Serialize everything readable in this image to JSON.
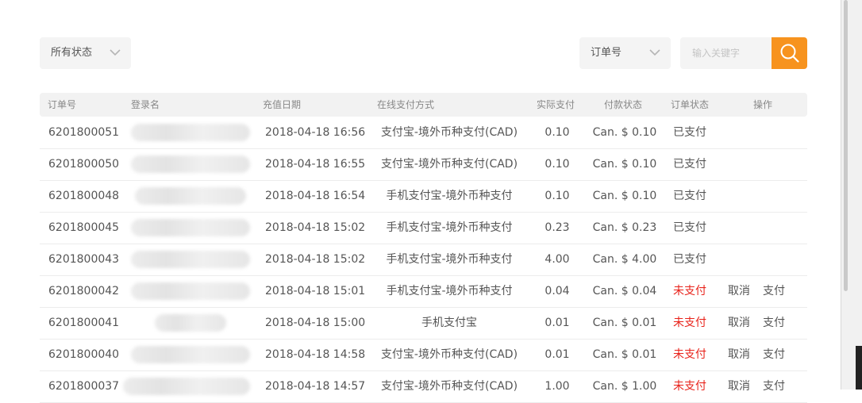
{
  "filters": {
    "status_select": "所有状态",
    "field_select": "订单号",
    "search_placeholder": "输入关键字"
  },
  "table": {
    "headers": [
      "订单号",
      "登录名",
      "充值日期",
      "在线支付方式",
      "实际支付",
      "付款状态",
      "订单状态",
      "操作"
    ],
    "rows": [
      {
        "id": "6201800051",
        "date": "2018-04-18 16:56",
        "method": "支付宝-境外币种支付(CAD)",
        "amount": "0.10",
        "payment": "Can. $ 0.10",
        "status": "已支付",
        "actions": []
      },
      {
        "id": "6201800050",
        "date": "2018-04-18 16:55",
        "method": "支付宝-境外币种支付(CAD)",
        "amount": "0.10",
        "payment": "Can. $ 0.10",
        "status": "已支付",
        "actions": []
      },
      {
        "id": "6201800048",
        "date": "2018-04-18 16:54",
        "method": "手机支付宝-境外币种支付",
        "amount": "0.10",
        "payment": "Can. $ 0.10",
        "status": "已支付",
        "actions": []
      },
      {
        "id": "6201800045",
        "date": "2018-04-18 15:02",
        "method": "手机支付宝-境外币种支付",
        "amount": "0.23",
        "payment": "Can. $ 0.23",
        "status": "已支付",
        "actions": []
      },
      {
        "id": "6201800043",
        "date": "2018-04-18 15:02",
        "method": "手机支付宝-境外币种支付",
        "amount": "4.00",
        "payment": "Can. $ 4.00",
        "status": "已支付",
        "actions": []
      },
      {
        "id": "6201800042",
        "date": "2018-04-18 15:01",
        "method": "手机支付宝-境外币种支付",
        "amount": "0.04",
        "payment": "Can. $ 0.04",
        "status": "未支付",
        "actions": [
          "取消",
          "支付"
        ]
      },
      {
        "id": "6201800041",
        "date": "2018-04-18 15:00",
        "method": "手机支付宝",
        "amount": "0.01",
        "payment": "Can. $ 0.01",
        "status": "未支付",
        "actions": [
          "取消",
          "支付"
        ]
      },
      {
        "id": "6201800040",
        "date": "2018-04-18 14:58",
        "method": "支付宝-境外币种支付(CAD)",
        "amount": "0.01",
        "payment": "Can. $ 0.01",
        "status": "未支付",
        "actions": [
          "取消",
          "支付"
        ]
      },
      {
        "id": "6201800037",
        "date": "2018-04-18 14:57",
        "method": "支付宝-境外币种支付(CAD)",
        "amount": "1.00",
        "payment": "Can. $ 1.00",
        "status": "未支付",
        "actions": [
          "取消",
          "支付"
        ]
      }
    ]
  },
  "colors": {
    "accent": "#f7931e",
    "unpaid": "#e8231b",
    "header_bg": "#f2f2f2"
  },
  "icons": {
    "search": "search-icon",
    "dropdown": "chevron-down-icon"
  }
}
